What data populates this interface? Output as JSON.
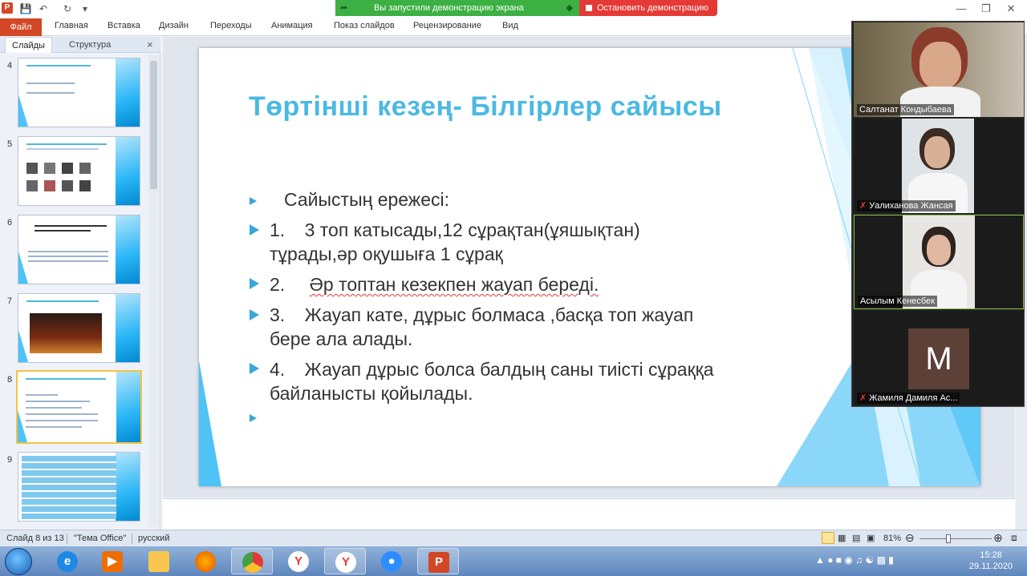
{
  "titlebar": {
    "app_icon": "P",
    "screen_share_text": "Вы запустили демонстрацию экрана",
    "stop_share_label": "Остановить демонстрацию"
  },
  "ribbon": {
    "file": "Файл",
    "tabs": [
      "Главная",
      "Вставка",
      "Дизайн",
      "Переходы",
      "Анимация",
      "Показ слайдов",
      "Рецензирование",
      "Вид"
    ]
  },
  "left_panel": {
    "tab_slides": "Слайды",
    "tab_outline": "Структура",
    "close": "×",
    "thumbnails": [
      {
        "num": "4",
        "lines": [
          "Екінші кезең- Әр топ жеке таныстыру",
          "Топтың аты",
          "Топтың ұраны"
        ]
      },
      {
        "num": "5",
        "lines": [
          "Бірінші кезең - Мен деген сұрақтарға жауап беру"
        ]
      },
      {
        "num": "6",
        "lines": [
          "Үшінші кезең - Сағынған сайыс - «Ғылым әлемі»"
        ]
      },
      {
        "num": "7",
        "lines": [
          "Кай жерде және Ғимараттың аталым аты"
        ]
      },
      {
        "num": "8",
        "lines": [
          "Төртінші кезең- Білгірлер сайысы"
        ]
      },
      {
        "num": "9",
        "lines": [
          ""
        ]
      }
    ]
  },
  "slide": {
    "title": "Төртінші кезең-  Білгірлер сайысы",
    "intro": "Сайыстың ережесі:",
    "rules": [
      {
        "num": "1.",
        "line1": "3 топ катысады,12 сұрақтан(ұяшықтан)",
        "line2": "тұрады,әр оқушыға 1 сұрақ"
      },
      {
        "num": "2.",
        "line1": "Әр топтан кезекпен жауап береді.",
        "line2": ""
      },
      {
        "num": "3.",
        "line1": "Жауап кате, дұрыс болмаса ,басқа топ жауап",
        "line2": "бере  ала алады."
      },
      {
        "num": "4.",
        "line1": "Жауап дұрыс болса балдың саны  тиісті сұраққа",
        "line2": "байланысты қойылады."
      }
    ]
  },
  "status": {
    "slide_info": "Слайд 8 из 13",
    "theme": "\"Тема Office\"",
    "language": "русский",
    "zoom": "81%",
    "zoom_level": 0.81
  },
  "video": {
    "participants": [
      {
        "name": "Салтанат Кондыбаева",
        "muted": false
      },
      {
        "name": "Уалиханова Жансая",
        "muted": true
      },
      {
        "name": "Асылым Кенесбек",
        "muted": false
      },
      {
        "name": "Жамиля Дамиля Ас...",
        "muted": true,
        "avatar_letter": "M"
      }
    ]
  },
  "tray": {
    "time": "15:28",
    "date": "29.11.2020"
  },
  "colors": {
    "title_blue": "#4ab9e3",
    "file_tab": "#d24726",
    "share_green": "#3cb043",
    "stop_red": "#e53935",
    "active_slide_border": "#f5c342"
  }
}
